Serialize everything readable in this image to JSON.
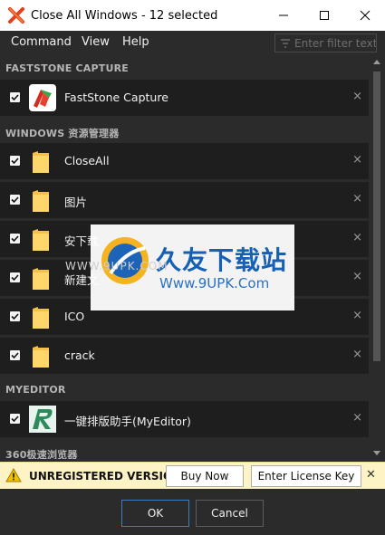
{
  "window": {
    "title": "Close All Windows - 12 selected",
    "minimize_glyph": "—",
    "maximize_glyph": "☐",
    "close_glyph": "✕"
  },
  "menu": {
    "items": [
      "Command",
      "View",
      "Help"
    ]
  },
  "filter": {
    "placeholder": "Enter filter text"
  },
  "groups": [
    {
      "header": "FASTSTONE CAPTURE",
      "rows": [
        {
          "label": "FastStone Capture",
          "icon": "faststone-capture-icon",
          "checked": true
        }
      ]
    },
    {
      "header": "WINDOWS 资源管理器",
      "rows": [
        {
          "label": "CloseAll",
          "icon": "folder-icon",
          "checked": true
        },
        {
          "label": "图片",
          "icon": "folder-icon",
          "checked": true
        },
        {
          "label": "安下载",
          "icon": "folder-icon",
          "checked": true
        },
        {
          "label": "新建文",
          "icon": "folder-icon",
          "checked": true
        },
        {
          "label": "ICO",
          "icon": "folder-icon",
          "checked": true
        },
        {
          "label": "crack",
          "icon": "folder-icon",
          "checked": true
        }
      ]
    },
    {
      "header": "MYEDITOR",
      "rows": [
        {
          "label": "一键排版助手(MyEditor)",
          "icon": "myeditor-icon",
          "checked": true
        }
      ]
    },
    {
      "header": "360极速浏览器",
      "rows": []
    }
  ],
  "row_close_glyph": "×",
  "notice": {
    "text": "UNREGISTERED VERSIO",
    "buy_label": "Buy Now",
    "license_label": "Enter License Key",
    "close_glyph": "✕"
  },
  "footer": {
    "ok_label": "OK",
    "cancel_label": "Cancel"
  },
  "watermark": {
    "title": "久友下载站",
    "url": "Www.9UPK.Com",
    "overlay_text": "WWW.9UPK.COM"
  },
  "colors": {
    "background": "#2b2b2b",
    "row_background": "#1e1e1e",
    "notice_background": "#fdf3c4",
    "accent_blue": "#3c7fc0"
  }
}
